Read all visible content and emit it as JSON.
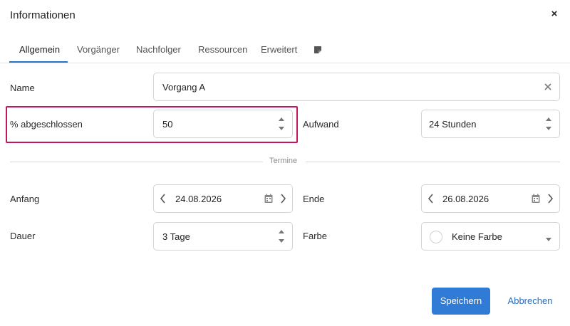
{
  "dialog": {
    "title": "Informationen",
    "close_glyph": "×"
  },
  "tabs": [
    {
      "label": "Allgemein",
      "active": true
    },
    {
      "label": "Vorgänger",
      "active": false
    },
    {
      "label": "Nachfolger",
      "active": false
    },
    {
      "label": "Ressourcen",
      "active": false
    },
    {
      "label": "Erweitert",
      "active": false
    }
  ],
  "tab_extra_icon": "note-icon",
  "form": {
    "name_label": "Name",
    "name_value": "Vorgang A",
    "percent_label": "% abgeschlossen",
    "percent_value": "50",
    "effort_label": "Aufwand",
    "effort_value": "24 Stunden",
    "section_label": "Termine",
    "start_label": "Anfang",
    "start_value": "24.08.2026",
    "end_label": "Ende",
    "end_value": "26.08.2026",
    "duration_label": "Dauer",
    "duration_value": "3 Tage",
    "color_label": "Farbe",
    "color_value": "Keine Farbe"
  },
  "footer": {
    "save_label": "Speichern",
    "cancel_label": "Abbrechen"
  },
  "colors": {
    "accent": "#2f7bd6",
    "highlight": "#c2185b"
  }
}
